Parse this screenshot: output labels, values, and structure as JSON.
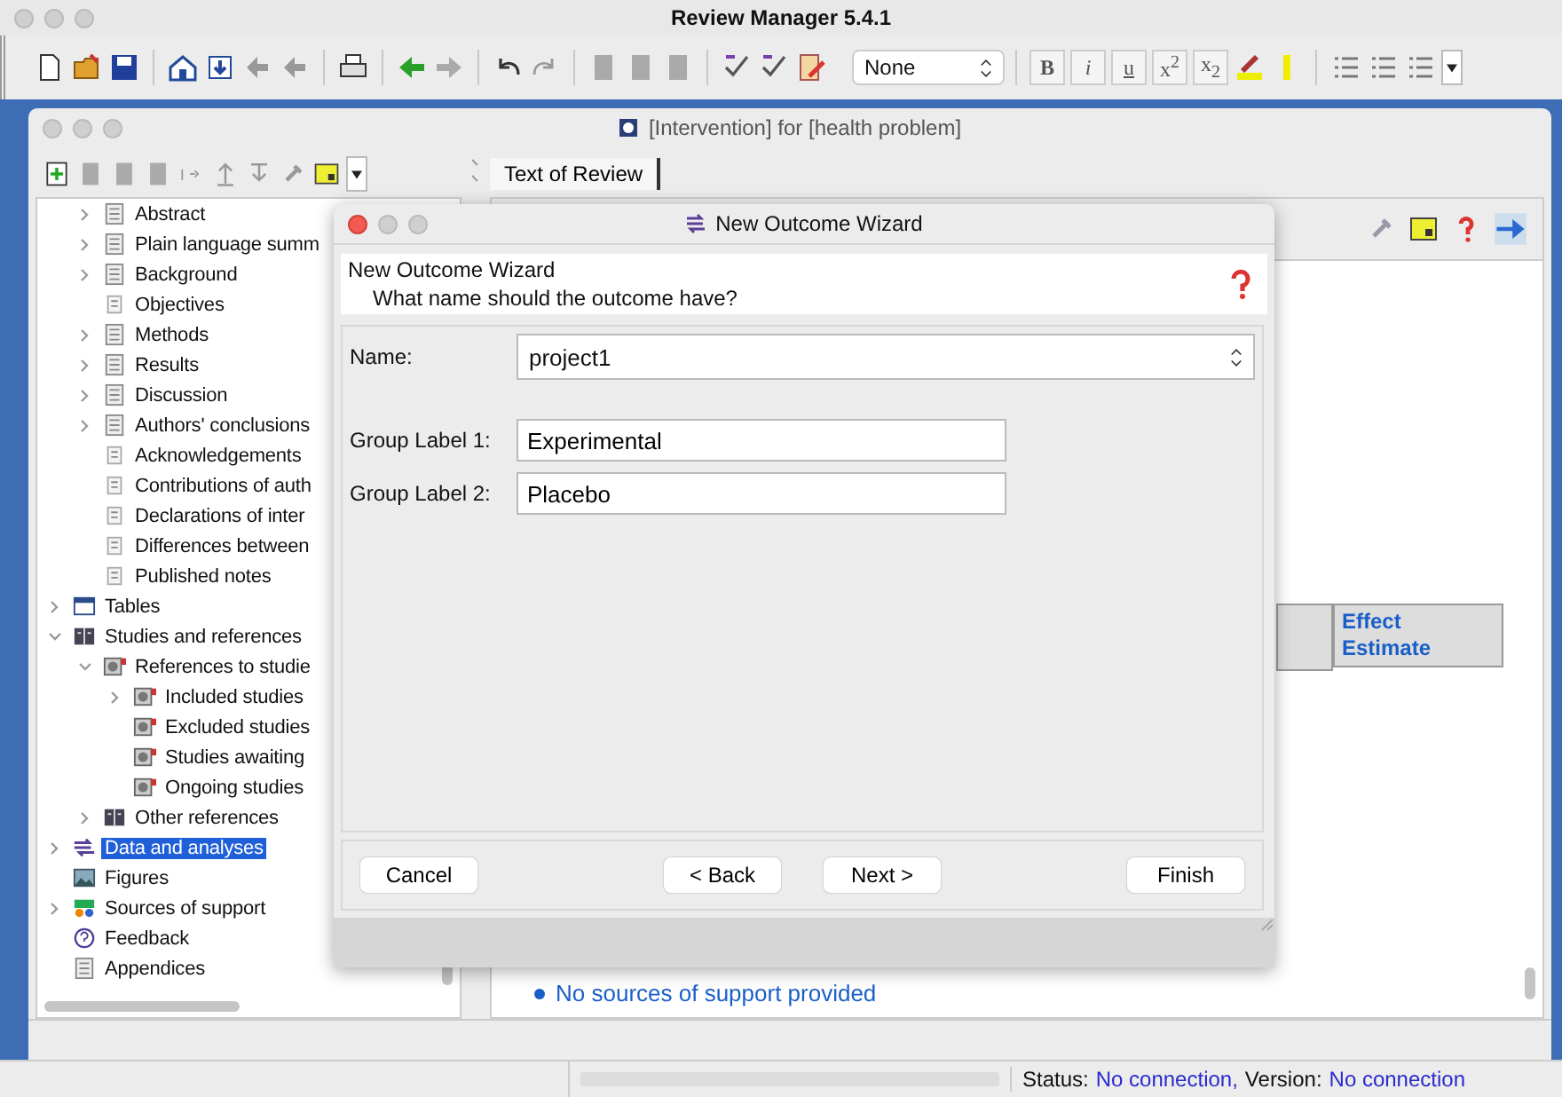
{
  "app": {
    "title": "Review Manager 5.4.1"
  },
  "toolbar": {
    "style_select": {
      "value": "None"
    },
    "format_buttons": [
      {
        "label": "B",
        "kind": "bold"
      },
      {
        "label": "i",
        "kind": "italic"
      },
      {
        "label": "u",
        "kind": "underline"
      },
      {
        "label": "x$^{2}$",
        "kind": "plain"
      },
      {
        "label": "x$_{2}$",
        "kind": "plain"
      }
    ]
  },
  "document_window": {
    "title": "[Intervention] for [health problem]",
    "tabs": [
      {
        "label": "Text of Review",
        "selected": true
      }
    ]
  },
  "tree": {
    "scrolled_section_items": [
      {
        "label": "Abstract",
        "kind": "doc",
        "expanded": false
      },
      {
        "label": "Plain language summ",
        "kind": "doc",
        "expanded": false
      },
      {
        "label": "Background",
        "kind": "doc",
        "expanded": false
      },
      {
        "label": "Objectives",
        "kind": "leafdoc"
      },
      {
        "label": "Methods",
        "kind": "doc",
        "expanded": false
      },
      {
        "label": "Results",
        "kind": "doc",
        "expanded": false
      },
      {
        "label": "Discussion",
        "kind": "doc",
        "expanded": false
      },
      {
        "label": "Authors' conclusions",
        "kind": "doc",
        "expanded": false
      },
      {
        "label": "Acknowledgements",
        "kind": "leafdoc"
      },
      {
        "label": "Contributions of auth",
        "kind": "leafdoc"
      },
      {
        "label": "Declarations of inter",
        "kind": "leafdoc"
      },
      {
        "label": "Differences between",
        "kind": "leafdoc"
      },
      {
        "label": "Published notes",
        "kind": "leafdoc"
      }
    ],
    "items": [
      {
        "label": "Tables",
        "kind": "table",
        "expanded": false,
        "selected": false
      },
      {
        "label": "Studies and references",
        "kind": "book",
        "expanded": true,
        "selected": false,
        "children": [
          {
            "label": "References to studie",
            "kind": "study",
            "expanded": true,
            "selected": false,
            "children": [
              {
                "label": "Included studies",
                "kind": "study",
                "expanded": false,
                "selected": false
              },
              {
                "label": "Excluded studies",
                "kind": "study",
                "selected": false
              },
              {
                "label": "Studies awaiting",
                "kind": "study",
                "selected": false
              },
              {
                "label": "Ongoing studies",
                "kind": "study",
                "selected": false
              }
            ]
          },
          {
            "label": "Other references",
            "kind": "book",
            "expanded": false,
            "selected": false
          }
        ]
      },
      {
        "label": "Data and analyses",
        "kind": "data",
        "expanded": false,
        "selected": true
      },
      {
        "label": "Figures",
        "kind": "figure",
        "selected": false
      },
      {
        "label": "Sources of support",
        "kind": "support",
        "expanded": false,
        "selected": false
      },
      {
        "label": "Feedback",
        "kind": "feedback",
        "selected": false
      },
      {
        "label": "Appendices",
        "kind": "doc",
        "selected": false
      }
    ]
  },
  "content": {
    "table_header": "Effect Estimate",
    "bullet_text": "No sources of support provided"
  },
  "status_bar": [
    {
      "label": "Status:",
      "value": "No connection,"
    },
    {
      "label": "Version:",
      "value": "No connection"
    }
  ],
  "dialog": {
    "title": "New Outcome Wizard",
    "heading": "New Outcome Wizard",
    "question": "What name should the outcome have?",
    "fields": [
      {
        "label": "Name:",
        "value": "project1",
        "kind": "combo"
      },
      {
        "label": "Group Label 1:",
        "value": "Experimental",
        "kind": "text"
      },
      {
        "label": "Group Label 2:",
        "value": "Placebo",
        "kind": "text"
      }
    ],
    "buttons": [
      "Cancel",
      "< Back",
      "Next >",
      "Finish"
    ]
  }
}
